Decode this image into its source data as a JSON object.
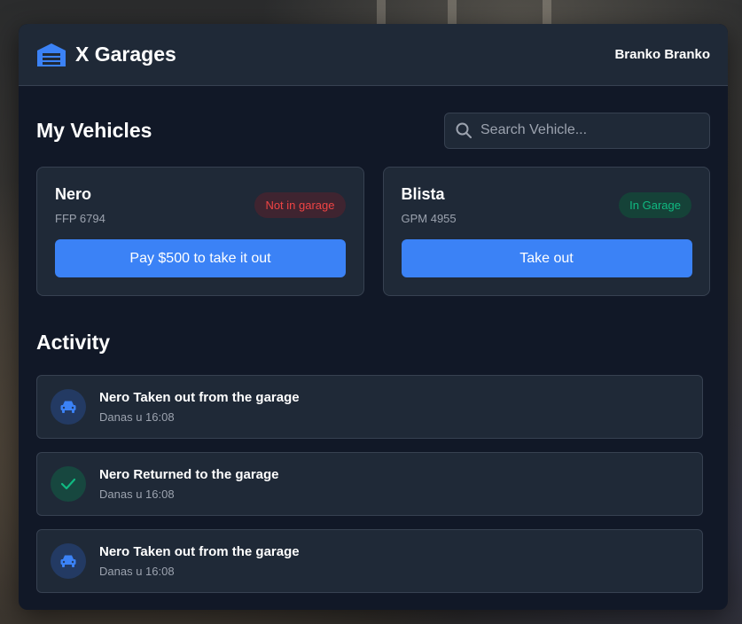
{
  "header": {
    "title": "X Garages",
    "user": "Branko Branko"
  },
  "vehicles_section": {
    "title": "My Vehicles",
    "search_placeholder": "Search Vehicle..."
  },
  "vehicles": [
    {
      "name": "Nero",
      "plate": "FFP 6794",
      "status": "Not in garage",
      "action": "Pay $500 to take it out"
    },
    {
      "name": "Blista",
      "plate": "GPM 4955",
      "status": "In Garage",
      "action": "Take out"
    }
  ],
  "activity": {
    "title": "Activity",
    "items": [
      {
        "icon": "car-icon",
        "text": "Nero Taken out from the garage",
        "time": "Danas u 16:08"
      },
      {
        "icon": "check-icon",
        "text": "Nero Returned to the garage",
        "time": "Danas u 16:08"
      },
      {
        "icon": "car-icon",
        "text": "Nero Taken out from the garage",
        "time": "Danas u 16:08"
      }
    ]
  },
  "colors": {
    "accent": "#3b82f6",
    "status_out": "#ef4444",
    "status_in": "#10b981",
    "panel_bg": "#111827",
    "card_bg": "#1f2937"
  }
}
